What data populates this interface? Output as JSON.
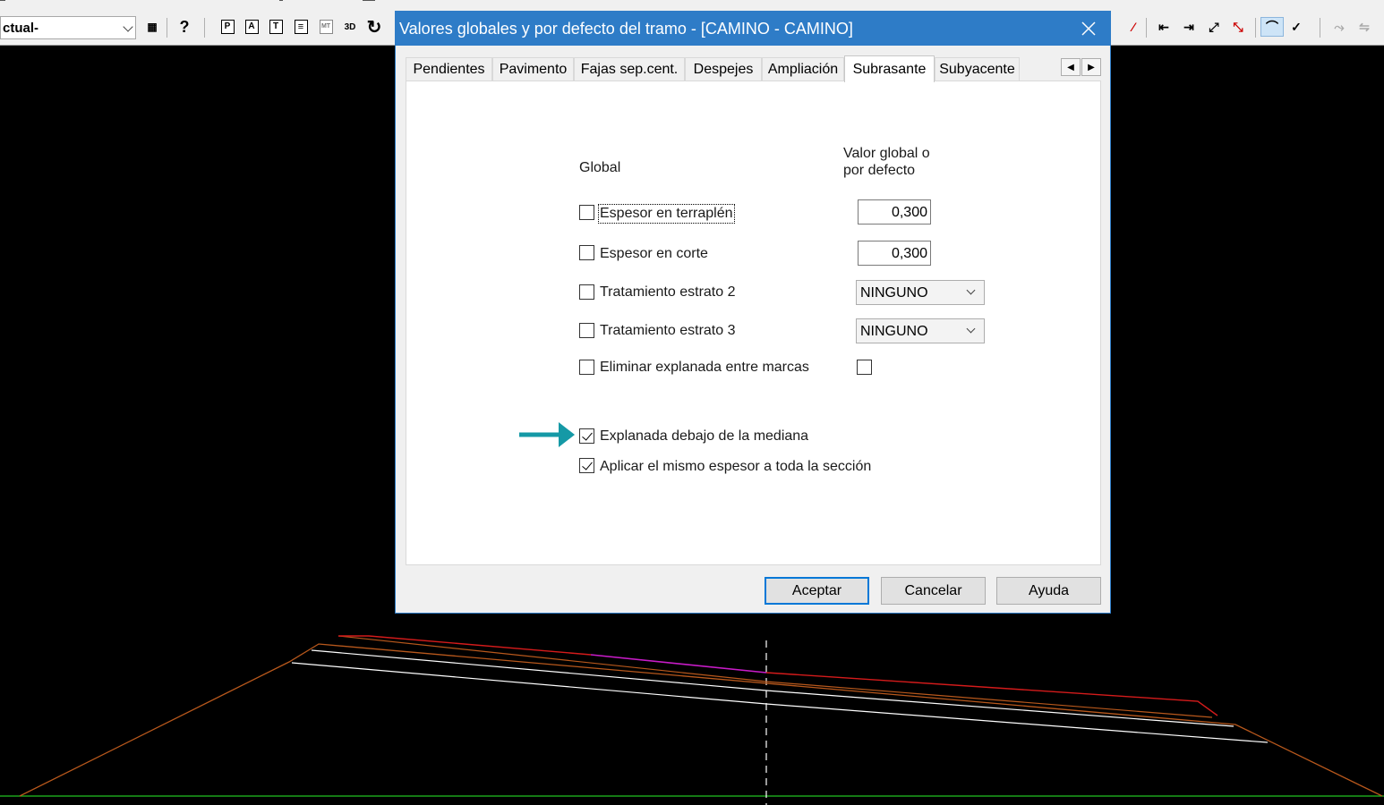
{
  "toolbar": {
    "layer_combo_value": "ctual-",
    "buttons": [
      {
        "name": "table-icon",
        "glyph": "▦"
      },
      {
        "name": "help-icon",
        "glyph": "?"
      },
      {
        "name": "p-icon",
        "glyph": "P"
      },
      {
        "name": "a-icon",
        "glyph": "A"
      },
      {
        "name": "t-icon",
        "glyph": "T"
      },
      {
        "name": "lines-icon",
        "glyph": "≡"
      },
      {
        "name": "mt-icon",
        "glyph": "MT"
      },
      {
        "name": "3d-icon",
        "glyph": "3D"
      },
      {
        "name": "refresh-icon",
        "glyph": "↻"
      }
    ]
  },
  "dialog": {
    "title": "Valores globales y por defecto del tramo  - [CAMINO - CAMINO]",
    "tabs": [
      "Pendientes",
      "Pavimento",
      "Fajas sep.cent.",
      "Despejes",
      "Ampliación",
      "Subrasante",
      "Subyacente"
    ],
    "active_tab": "Subrasante",
    "header_global": "Global",
    "header_value": "Valor global o",
    "header_value_2": "por defecto",
    "rows": {
      "espesor_terraplen": {
        "label": "Espesor en terraplén",
        "checked": false,
        "value": "0,300"
      },
      "espesor_corte": {
        "label": "Espesor en corte",
        "checked": false,
        "value": "0,300"
      },
      "estrato2": {
        "label": "Tratamiento estrato 2",
        "checked": false,
        "value": "NINGUNO"
      },
      "estrato3": {
        "label": "Tratamiento estrato 3",
        "checked": false,
        "value": "NINGUNO"
      },
      "eliminar": {
        "label": "Eliminar explanada entre marcas",
        "checked": false,
        "value_checked": false
      },
      "explanada_mediana": {
        "label": "Explanada debajo de la mediana",
        "checked": true
      },
      "mismo_espesor": {
        "label": "Aplicar el mismo espesor a toda la sección",
        "checked": true
      }
    },
    "buttons": {
      "ok": "Aceptar",
      "cancel": "Cancelar",
      "help": "Ayuda"
    }
  },
  "colors": {
    "title_bar": "#2e7cc7",
    "annotation_arrow": "#1599a6",
    "canvas_background": "#000000"
  }
}
